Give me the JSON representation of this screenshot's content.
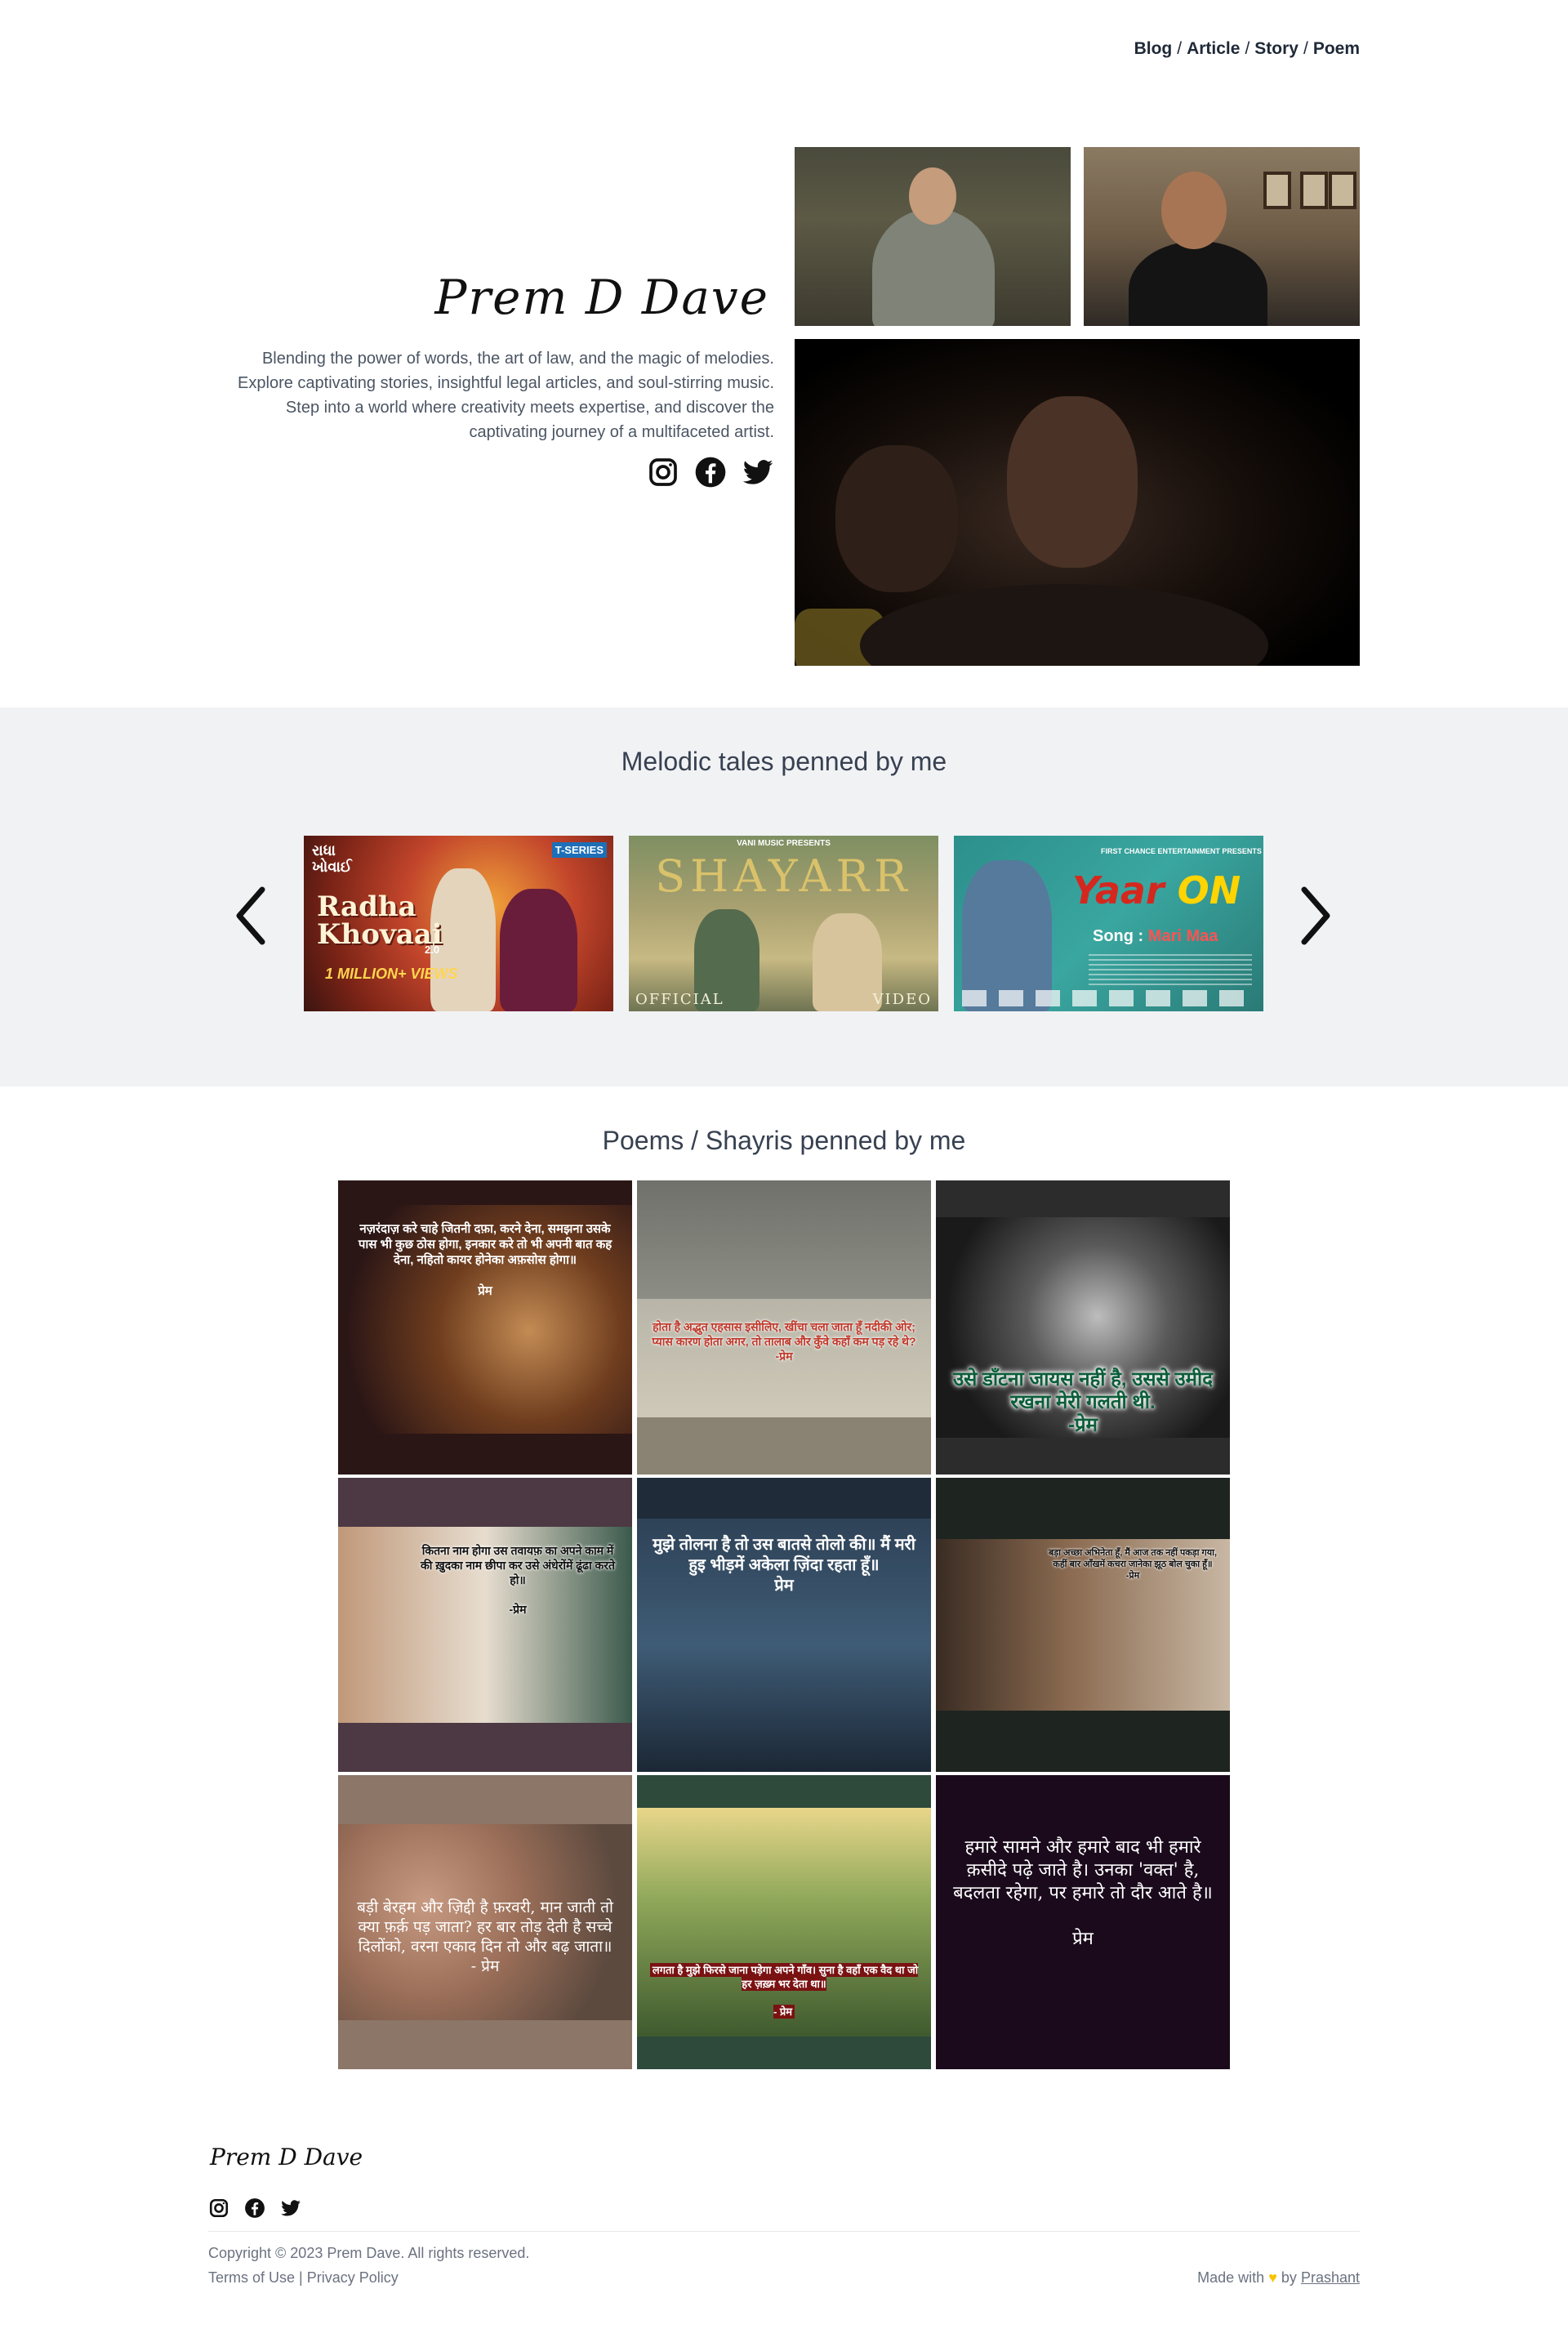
{
  "nav": {
    "items": [
      "Blog",
      "Article",
      "Story",
      "Poem"
    ],
    "separator": "/"
  },
  "hero": {
    "brand": "Prem D Dave",
    "paragraph1": "Blending the power of words, the art of law, and the magic of melodies. Explore captivating stories, insightful legal articles, and soul-stirring music.",
    "paragraph2": "Step into a world where creativity meets expertise, and discover the captivating journey of a multifaceted artist.",
    "social": [
      "instagram-icon",
      "facebook-icon",
      "twitter-icon"
    ]
  },
  "melodic": {
    "title": "Melodic tales penned by me",
    "thumbs": [
      {
        "small": "રાધા\nખોવાઈ",
        "logo": "T-SERIES",
        "title": "Radha\nKhovaai",
        "sub": "2.0",
        "views": "1 MILLION+ VIEWS"
      },
      {
        "top": "VANI MUSIC PRESENTS",
        "title": "SHAYARR",
        "foot_left": "OFFICIAL",
        "foot_right": "VIDEO"
      },
      {
        "top": "FIRST CHANCE ENTERTAINMENT PRESENTS",
        "title_a": "Yaar",
        "title_b": "ON",
        "song_label": "Song :",
        "song_name": "Mari Maa"
      }
    ]
  },
  "poems": {
    "title": "Poems / Shayris penned by me",
    "items": [
      "नज़रंदाज़ करे चाहे जितनी दफ़ा, करने देना, समझना उसके पास भी कुछ ठोस होगा, इनकार करे तो भी अपनी बात कह देना, नहितो कायर होनेका अफ़सोस होगा॥\n\nप्रेम",
      "होता है अद्भुत एहसास इसीलिए, खींचा चला जाता हूँ नदीकी ओर; प्यास कारण होता अगर, तो तालाब और कुँवे कहाँ कम पड़ रहे थे?\n-प्रेम",
      "उसे डाँटना जायस नहीं है, उससे उमीद रखना मेरी गलती थी.\n-प्रेम",
      "कितना नाम होगा उस तवायफ़ का अपने काम में\nकी ख़ुदका नाम छीपा कर उसे अंधेरोंमें ढूंढा करते हो॥\n\n-प्रेम",
      "मुझे तोलना है तो उस बातसे तोलो की॥ मैं मरी हुइ भीड़में अकेला ज़िंदा रहता हूँ॥\nप्रेम",
      "बड़ा अच्छा अभिनेता हूँ, मैं आज तक नहीं पकड़ा गया,\nकहीं बार आँखमें कचरा जानेका झूठ बोल चुका हूँ॥\n-प्रेम",
      "बड़ी बेरहम और ज़िद्दी है फ़रवरी, मान जाती तो क्या फ़र्क़ पड़ जाता? हर बार तोड़ देती है सच्चे दिलोंको, वरना एकाद दिन तो और बढ़ जाता॥\n- प्रेम",
      "लगता है मुझे फिरसे जाना पड़ेगा अपने गाँव। सुना है वहाँ एक वैद था जो हर ज़ख़्म भर देता था॥\n\n- प्रेम",
      "हमारे सामने और हमारे बाद भी हमारे क़सीदे पढ़े जाते है। उनका 'वक्त' है, बदलता रहेगा, पर हमारे तो दौर आते है॥\n\nप्रेम"
    ]
  },
  "footer": {
    "brand": "Prem D Dave",
    "copyright": "Copyright © 2023 Prem Dave. All rights reserved.",
    "terms": "Terms of Use",
    "link_sep": "|",
    "privacy": "Privacy Policy",
    "made_with": "Made with",
    "heart": "♥",
    "by": "by",
    "author": "Prashant"
  },
  "colors": {
    "accent_yellow": "#f5c400",
    "section_bg": "#f1f2f4",
    "text_dark": "#1f2937",
    "text_muted": "#6b7280"
  }
}
